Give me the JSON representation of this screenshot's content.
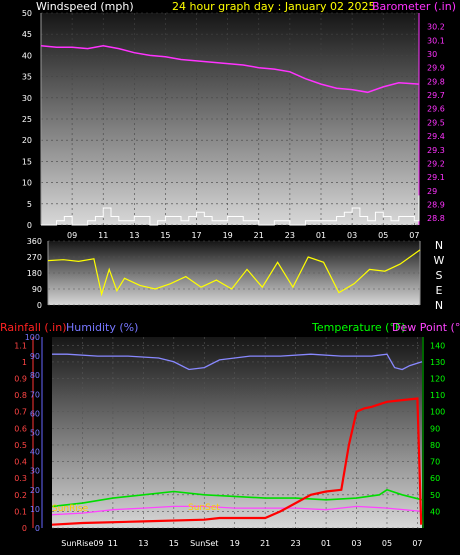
{
  "header": {
    "wind_label": "Windspeed (mph)",
    "title": "24 hour graph day : January 02 2025",
    "baro_label": "Barometer (.in)"
  },
  "compass_letters": [
    "N",
    "W",
    "S",
    "E",
    "N"
  ],
  "lower_header": {
    "rain_label": "Rainfall (.in)",
    "humidity_label": "Humidity (%)",
    "temp_label": "Temperature (°F)",
    "dew_label": "Dew Point (°F)"
  },
  "annotations": {
    "sunrise": "SunRise",
    "sunset": "SunSet"
  },
  "colors": {
    "wind": "#ffffff",
    "barometer": "#ff33ff",
    "direction": "#ffff00",
    "humidity": "#8888ff",
    "temperature": "#00dd00",
    "dewpoint": "#ff44ff",
    "rainfall": "#ff0000",
    "title": "#ffff00",
    "rain_label": "#ff2222",
    "humidity_label": "#7777ff",
    "temp_label": "#00ff00",
    "dew_label": "#ff44ff"
  },
  "chart_data": [
    {
      "type": "line",
      "name": "wind_barometer",
      "x_ticks": [
        "09",
        "11",
        "13",
        "15",
        "17",
        "19",
        "21",
        "23",
        "01",
        "03",
        "05",
        "07"
      ],
      "x_range_hours": [
        7,
        31.3
      ],
      "y_left_ticks": [
        "0",
        "5",
        "10",
        "15",
        "20",
        "25",
        "30",
        "35",
        "40",
        "45",
        "50"
      ],
      "y_left_range": [
        0,
        50
      ],
      "y_right_ticks": [
        "28.8",
        "28.9",
        "29",
        "29.1",
        "29.2",
        "29.3",
        "29.4",
        "29.5",
        "29.6",
        "29.7",
        "29.8",
        "29.9",
        "30",
        "30.1",
        "30.2"
      ],
      "y_right_range": [
        28.75,
        30.3
      ],
      "series": [
        {
          "name": "Barometer",
          "axis": "right",
          "x": [
            7,
            8,
            9,
            10,
            11,
            12,
            13,
            14,
            15,
            16,
            17,
            18,
            19,
            20,
            21,
            22,
            23,
            24,
            25,
            26,
            27,
            28,
            29,
            30,
            31.3
          ],
          "values": [
            30.06,
            30.05,
            30.05,
            30.04,
            30.06,
            30.04,
            30.01,
            29.99,
            29.98,
            29.96,
            29.95,
            29.94,
            29.93,
            29.92,
            29.9,
            29.89,
            29.87,
            29.82,
            29.78,
            29.75,
            29.74,
            29.72,
            29.76,
            29.79,
            29.78
          ]
        },
        {
          "name": "Windspeed",
          "axis": "left",
          "x": [
            7,
            8,
            8.5,
            9,
            10,
            10.5,
            11,
            11.5,
            12,
            13,
            14,
            14.5,
            15,
            16,
            16.5,
            17,
            17.5,
            18,
            19,
            20,
            21,
            22,
            23,
            24,
            25,
            26,
            26.5,
            27,
            27.5,
            28,
            28.5,
            29,
            29.5,
            30,
            31,
            31.3
          ],
          "values": [
            0,
            1,
            2,
            0,
            1,
            2,
            4,
            2,
            1,
            2,
            0,
            1,
            2,
            1,
            2,
            3,
            2,
            1,
            2,
            1,
            0,
            1,
            0,
            1,
            1,
            2,
            3,
            4,
            2,
            1,
            3,
            2,
            1,
            2,
            1,
            7
          ]
        }
      ]
    },
    {
      "type": "line",
      "name": "wind_direction",
      "y_ticks": [
        "0",
        "90",
        "180",
        "270",
        "360"
      ],
      "y_range": [
        0,
        360
      ],
      "series": [
        {
          "name": "Wind Direction",
          "x": [
            7,
            8,
            9,
            10,
            10.5,
            11,
            11.5,
            12,
            13,
            14,
            15,
            16,
            17,
            18,
            19,
            20,
            21,
            22,
            23,
            24,
            25,
            26,
            27,
            28,
            29,
            30,
            31.3
          ],
          "values": [
            250,
            255,
            245,
            260,
            60,
            200,
            80,
            150,
            110,
            90,
            120,
            160,
            100,
            140,
            90,
            200,
            100,
            240,
            100,
            270,
            240,
            70,
            120,
            200,
            190,
            230,
            310
          ]
        }
      ]
    },
    {
      "type": "line",
      "name": "humidity_temp_rain",
      "x_ticks": [
        "SunRise09",
        "11",
        "13",
        "15",
        "SunSet",
        "19",
        "21",
        "23",
        "01",
        "03",
        "05",
        "07"
      ],
      "y_rain_ticks": [
        "0",
        "0.1",
        "0.2",
        "0.3",
        "0.4",
        "0.5",
        "0.6",
        "0.7",
        "0.8",
        "0.9",
        "1",
        "1.1"
      ],
      "y_rain_range": [
        0,
        1.15
      ],
      "y_humidity_ticks": [
        "0",
        "10",
        "20",
        "30",
        "40",
        "50",
        "60",
        "70",
        "80",
        "90",
        "100"
      ],
      "y_humidity_range": [
        0,
        100
      ],
      "y_temp_ticks": [
        "40",
        "50",
        "60",
        "70",
        "80",
        "90",
        "100",
        "110",
        "120",
        "130",
        "140"
      ],
      "y_temp_range": [
        30,
        145
      ],
      "series": [
        {
          "name": "Humidity",
          "axis": "humidity",
          "x": [
            7,
            8,
            10,
            12,
            14,
            15,
            16,
            17,
            18,
            19,
            20,
            22,
            24,
            26,
            28,
            29,
            29.5,
            30,
            30.5,
            31.3
          ],
          "values": [
            91,
            91,
            90,
            90,
            89,
            87,
            83,
            84,
            88,
            89,
            90,
            90,
            91,
            90,
            90,
            91,
            84,
            83,
            85,
            87
          ]
        },
        {
          "name": "Temperature",
          "axis": "temp",
          "x": [
            7,
            9,
            11,
            13,
            15,
            17,
            19,
            21,
            23,
            25,
            27,
            28.5,
            29,
            30,
            31.3
          ],
          "values": [
            43,
            45,
            48,
            50,
            52,
            50,
            49,
            48,
            48,
            47,
            48,
            50,
            53,
            50,
            47
          ]
        },
        {
          "name": "Dew Point",
          "axis": "temp",
          "x": [
            7,
            9,
            11,
            13,
            15,
            17,
            19,
            21,
            23,
            25,
            27,
            29,
            31.3
          ],
          "values": [
            38,
            39,
            41,
            42,
            43,
            43,
            42,
            42,
            42,
            41,
            43,
            42,
            40
          ]
        },
        {
          "name": "Rainfall",
          "axis": "rain",
          "x": [
            7,
            9,
            13,
            17,
            18,
            21,
            22,
            23,
            24,
            25,
            26,
            26.5,
            27,
            27.5,
            28,
            29,
            30,
            31,
            31.25
          ],
          "values": [
            0.02,
            0.03,
            0.04,
            0.05,
            0.06,
            0.06,
            0.1,
            0.15,
            0.2,
            0.22,
            0.23,
            0.5,
            0.7,
            0.72,
            0.73,
            0.76,
            0.77,
            0.78,
            0.02
          ]
        }
      ]
    }
  ]
}
